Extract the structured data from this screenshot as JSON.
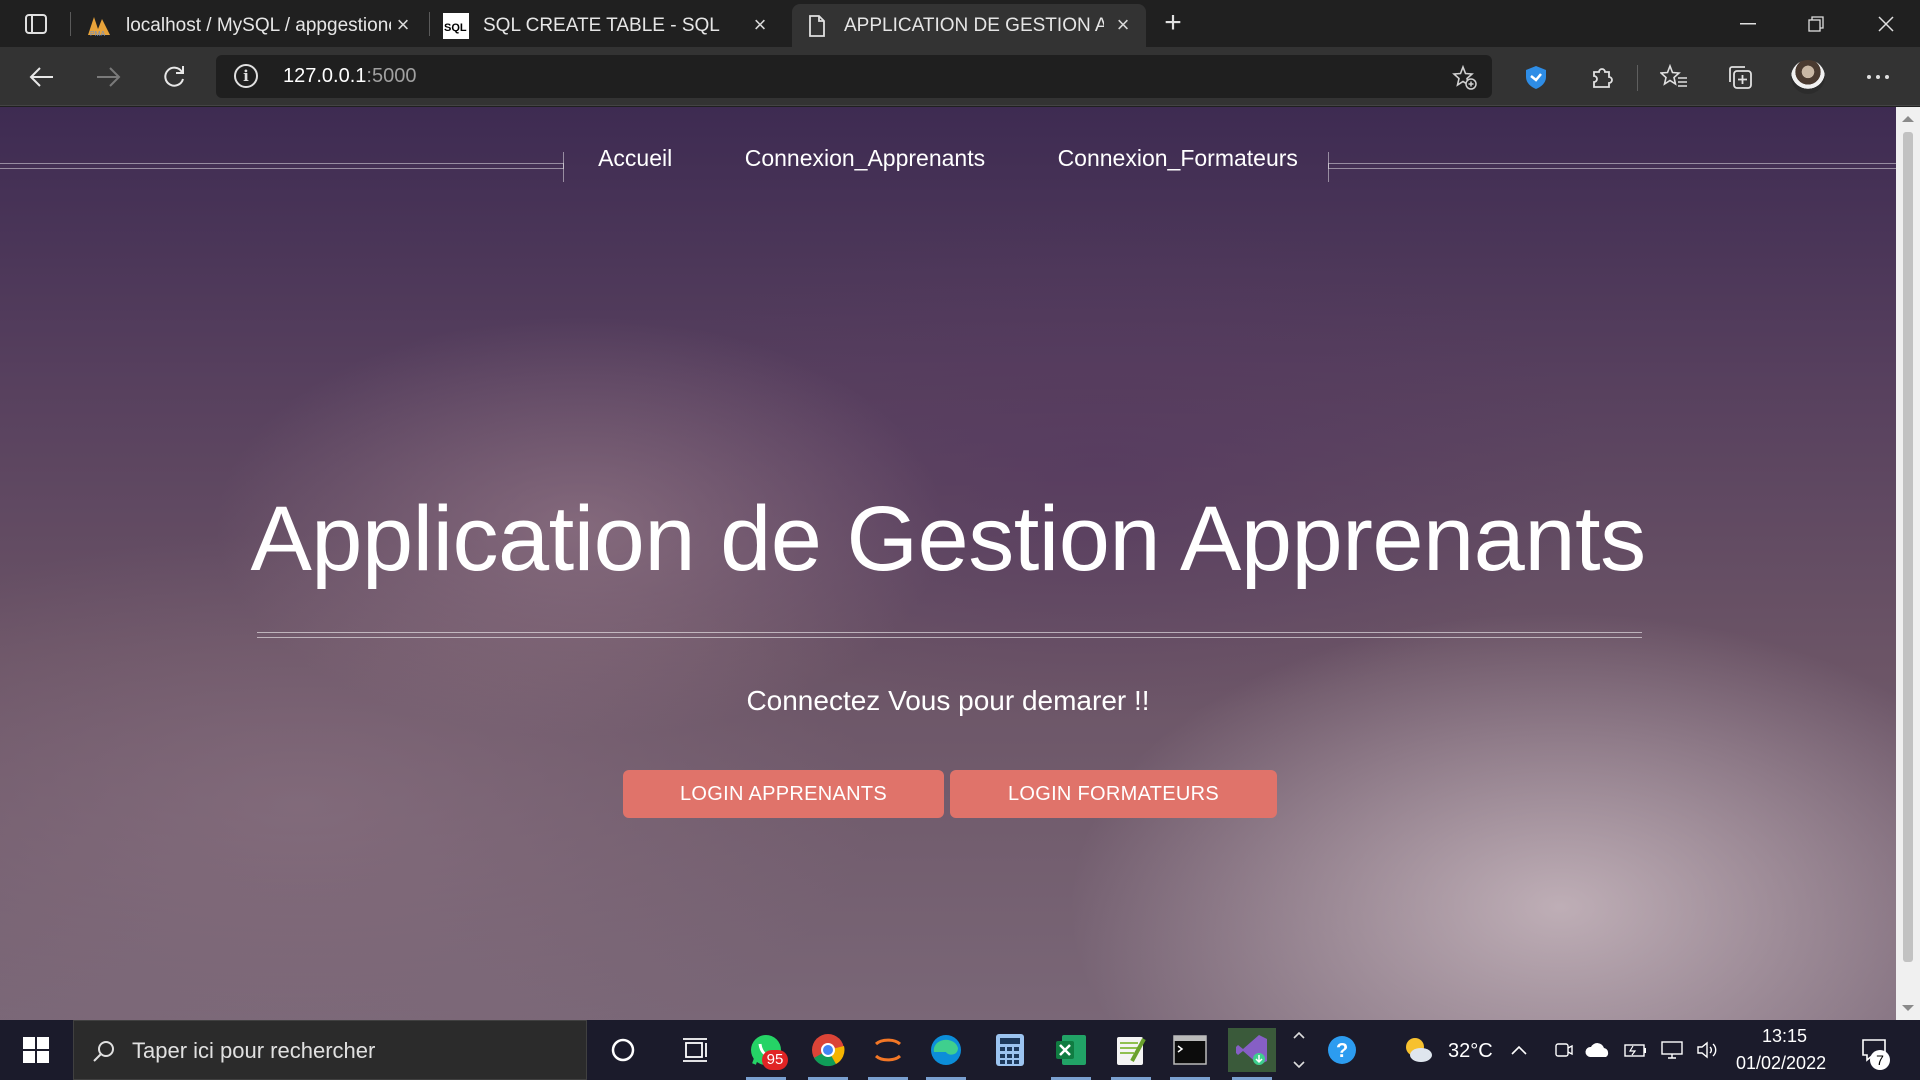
{
  "browser": {
    "tabs": [
      {
        "title": "localhost / MySQL / appgestione",
        "favicon": "phpmyadmin-icon"
      },
      {
        "title": "SQL CREATE TABLE - SQL",
        "favicon": "sql-icon"
      },
      {
        "title": "APPLICATION DE GESTION APPR",
        "favicon": "page-icon"
      }
    ],
    "active_tab": 2,
    "address": {
      "host": "127.0.0.1",
      "port": ":5000"
    }
  },
  "page": {
    "nav": [
      "Accueil",
      "Connexion_Apprenants",
      "Connexion_Formateurs"
    ],
    "title": "Application de Gestion Apprenants",
    "subtitle": "Connectez Vous pour demarer !!",
    "buttons": {
      "apprenants": "LOGIN APPRENANTS",
      "formateurs": "LOGIN FORMATEURS"
    },
    "colors": {
      "button": "#e0736a",
      "background_top": "#3e2b52",
      "background_bottom": "#7a6777"
    }
  },
  "taskbar": {
    "search_placeholder": "Taper ici pour rechercher",
    "whatsapp_badge": "95",
    "weather": "32°C",
    "time": "13:15",
    "date": "01/02/2022",
    "notifications": "7"
  }
}
